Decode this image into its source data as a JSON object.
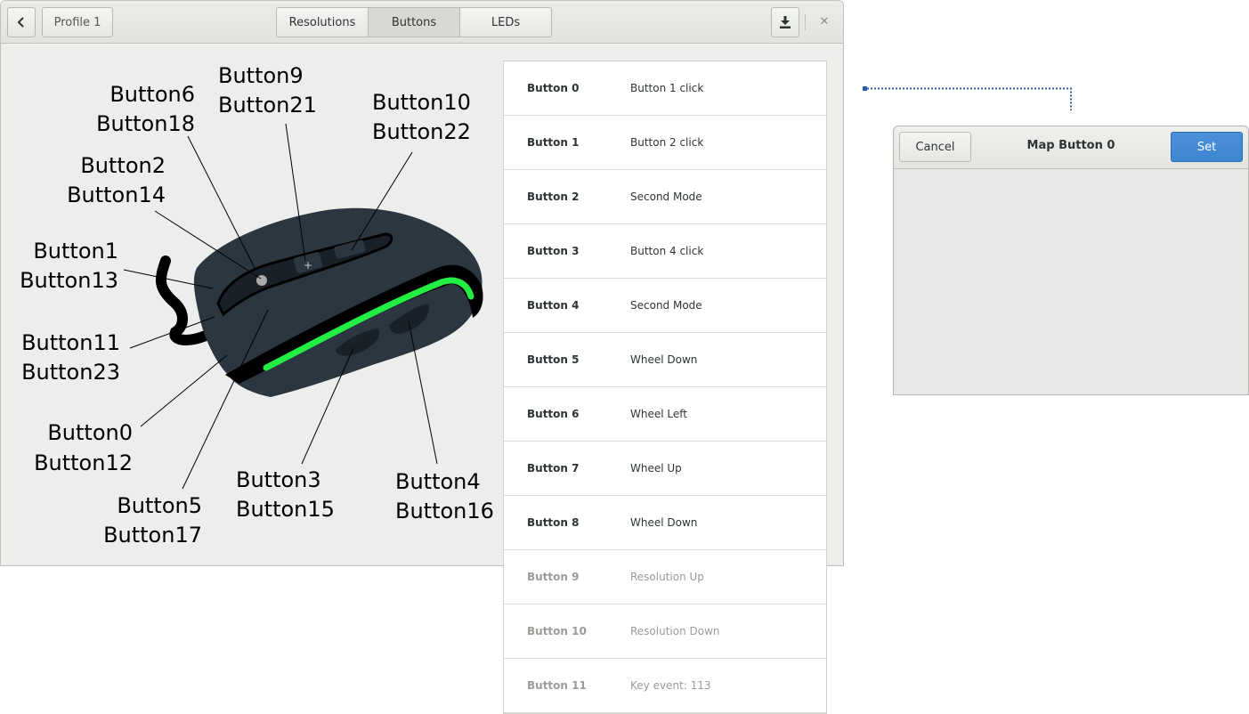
{
  "header": {
    "back_icon": "chevron-left-icon",
    "profile_label": "Profile 1",
    "tabs": [
      {
        "label": "Resolutions",
        "active": false
      },
      {
        "label": "Buttons",
        "active": true
      },
      {
        "label": "LEDs",
        "active": false
      }
    ],
    "save_icon": "download-icon",
    "close_glyph": "✕"
  },
  "mouse_labels": [
    {
      "line1": "Button6",
      "line2": "Button18"
    },
    {
      "line1": "Button9",
      "line2": "Button21"
    },
    {
      "line1": "Button10",
      "line2": "Button22"
    },
    {
      "line1": "Button2",
      "line2": "Button14"
    },
    {
      "line1": "Button1",
      "line2": "Button13"
    },
    {
      "line1": "Button11",
      "line2": "Button23"
    },
    {
      "line1": "Button0",
      "line2": "Button12"
    },
    {
      "line1": "Button3",
      "line2": "Button15"
    },
    {
      "line1": "Button4",
      "line2": "Button16"
    },
    {
      "line1": "Button5",
      "line2": "Button17"
    }
  ],
  "button_list": [
    {
      "name": "Button 0",
      "action": "Button 1 click"
    },
    {
      "name": "Button 1",
      "action": "Button 2 click"
    },
    {
      "name": "Button 2",
      "action": "Second Mode"
    },
    {
      "name": "Button 3",
      "action": "Button 4 click"
    },
    {
      "name": "Button 4",
      "action": "Second Mode"
    },
    {
      "name": "Button 5",
      "action": "Wheel Down"
    },
    {
      "name": "Button 6",
      "action": "Wheel Left"
    },
    {
      "name": "Button 7",
      "action": "Wheel Up"
    },
    {
      "name": "Button 8",
      "action": "Wheel Down"
    },
    {
      "name": "Button 9",
      "action": "Resolution Up"
    },
    {
      "name": "Button 10",
      "action": "Resolution Down"
    },
    {
      "name": "Button 11",
      "action": "Key event: 113"
    }
  ],
  "dialog": {
    "title": "Map Button 0",
    "cancel_label": "Cancel",
    "set_label": "Set"
  },
  "colors": {
    "mouse_body": "#2b3641",
    "led_green": "#22ee44",
    "accent_blue": "#4a90d9"
  }
}
